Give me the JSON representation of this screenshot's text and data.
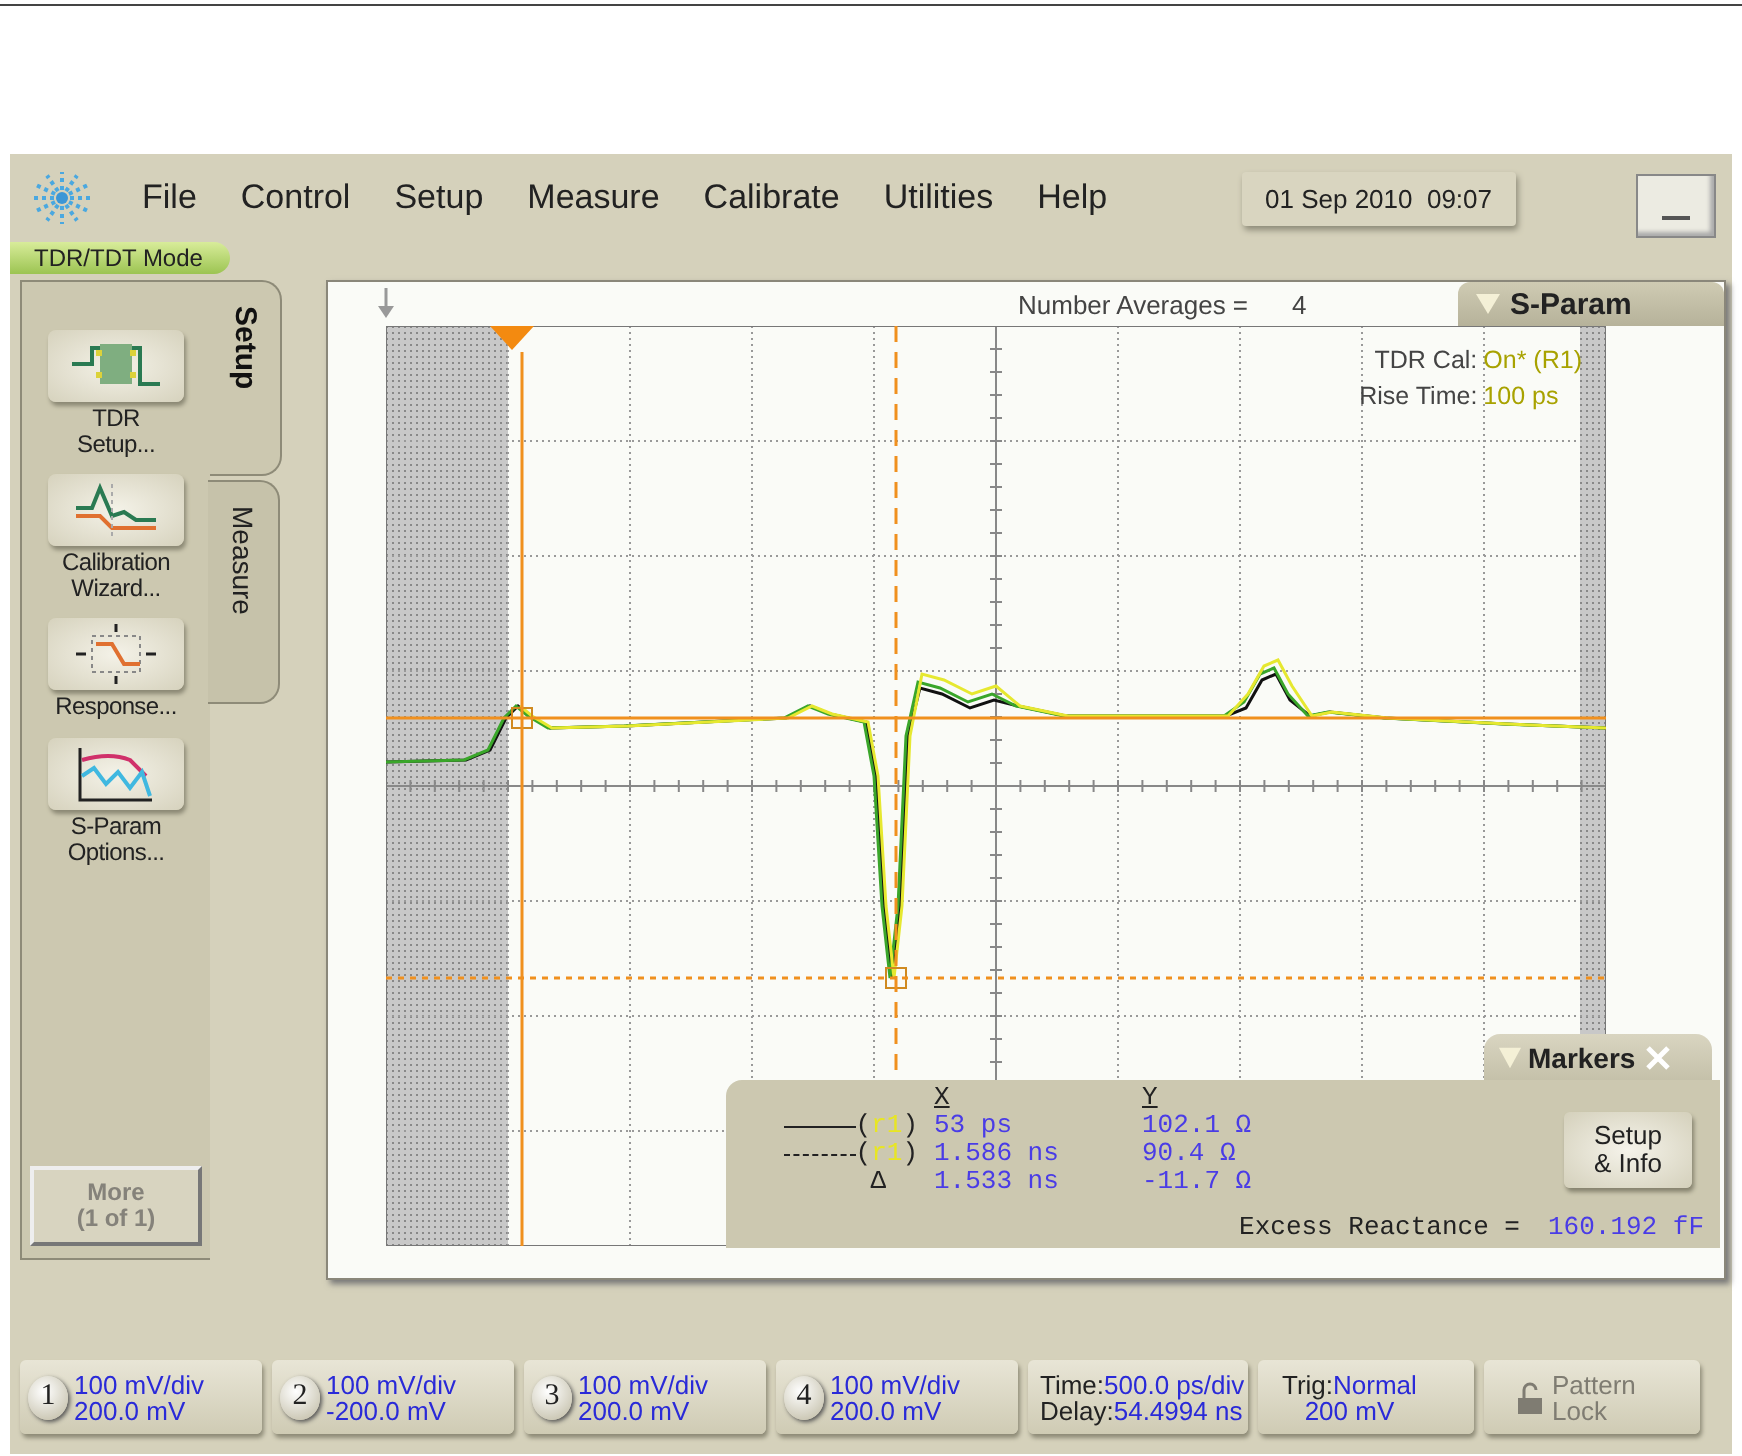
{
  "menu_bar": {
    "items": [
      "File",
      "Control",
      "Setup",
      "Measure",
      "Calibrate",
      "Utilities",
      "Help"
    ],
    "datetime": "01 Sep 2010  09:07"
  },
  "mode_label": "TDR/TDT Mode",
  "side_panel": {
    "tabs": [
      {
        "label": "Setup",
        "selected": true
      },
      {
        "label": "Measure",
        "selected": false
      }
    ],
    "buttons": [
      {
        "kind": "tdr-setup",
        "label": "TDR\nSetup..."
      },
      {
        "kind": "calibration",
        "label": "Calibration\nWizard..."
      },
      {
        "kind": "response",
        "label": "Response..."
      },
      {
        "kind": "sparam",
        "label": "S-Param\nOptions..."
      }
    ],
    "more_button": {
      "label": "More\n(1 of 1)",
      "disabled": true
    }
  },
  "display": {
    "averages_label": "Number Averages =",
    "averages_value": "4",
    "mode_tab": "S-Param",
    "info": [
      {
        "label": "TDR Cal:",
        "value": "On* (R1)"
      },
      {
        "label": "Rise Time:",
        "value": "100 ps"
      }
    ]
  },
  "markers": {
    "title": "Markers",
    "columns": [
      "X",
      "Y"
    ],
    "rows": [
      {
        "kind": "solid",
        "open": "(",
        "ref": "r1",
        "close": ")",
        "x": "53 ps",
        "y": "102.1 Ω"
      },
      {
        "kind": "dashed",
        "open": "(",
        "ref": "r1",
        "close": ")",
        "x": "1.586 ns",
        "y": "90.4 Ω"
      },
      {
        "kind": "delta",
        "symbol": "Δ",
        "x": "1.533 ns",
        "y": "-11.7 Ω"
      }
    ],
    "button": "Setup\n& Info",
    "excess_label": "Excess Reactance =",
    "excess_value": "160.192 fF"
  },
  "status_bar": {
    "channels": [
      {
        "number": "1",
        "scale": "100 mV/div",
        "offset": "200.0 mV"
      },
      {
        "number": "2",
        "scale": "100 mV/div",
        "offset": "-200.0 mV"
      },
      {
        "number": "3",
        "scale": "100 mV/div",
        "offset": "200.0 mV"
      },
      {
        "number": "4",
        "scale": "100 mV/div",
        "offset": "200.0 mV"
      }
    ],
    "timebase": [
      {
        "label": "Time:",
        "value": "500.0 ps/div"
      },
      {
        "label": "Delay:",
        "value": "54.4994 ns"
      }
    ],
    "trigger": [
      {
        "label": "Trig:",
        "value": "Normal"
      },
      {
        "value": "200 mV"
      }
    ],
    "pattern_lock": {
      "label": "Pattern\nLock",
      "disabled": true
    }
  }
}
